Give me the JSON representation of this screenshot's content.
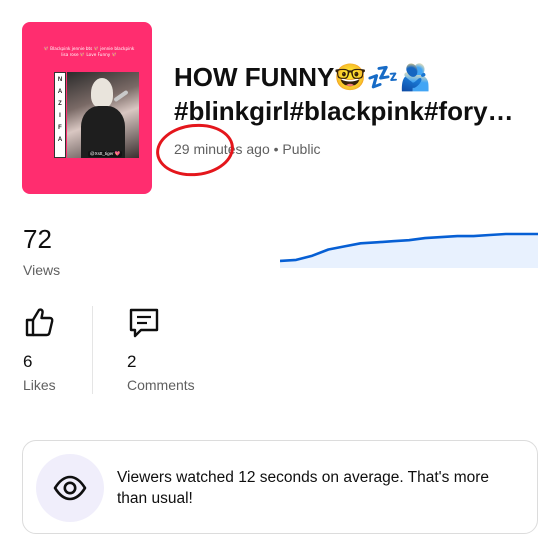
{
  "video": {
    "title_line1": "HOW FUNNY🤓💤🫂",
    "title_line2": "#blinkgirl#blackpink#fory…",
    "time_ago": "29 minutes ago",
    "separator": "•",
    "visibility": "Public",
    "thumbnail": {
      "caption": "💖 Blackpink jennie bts 💖 jennie blackpink lisa rose 💖 Love Funny 💖",
      "side_letters": [
        "N",
        "A",
        "Z",
        "I",
        "F",
        "A"
      ],
      "tag": "@Xstt_tiger 💖"
    }
  },
  "stats": {
    "views": "72",
    "views_label": "Views",
    "likes": "6",
    "likes_label": "Likes",
    "comments": "2",
    "comments_label": "Comments"
  },
  "sparkline": {
    "color": "#065fd4",
    "fill": "#e8f1fe",
    "values": [
      3,
      4,
      8,
      14,
      17,
      20,
      21,
      22,
      23,
      25,
      26,
      27,
      27,
      28,
      29,
      29,
      29
    ]
  },
  "insight": {
    "text": "Viewers watched 12 seconds on average. That's more than usual!"
  },
  "colors": {
    "thumbnail_bg": "#ff2d6f",
    "annotation": "#e4161c",
    "accent": "#065fd4"
  }
}
